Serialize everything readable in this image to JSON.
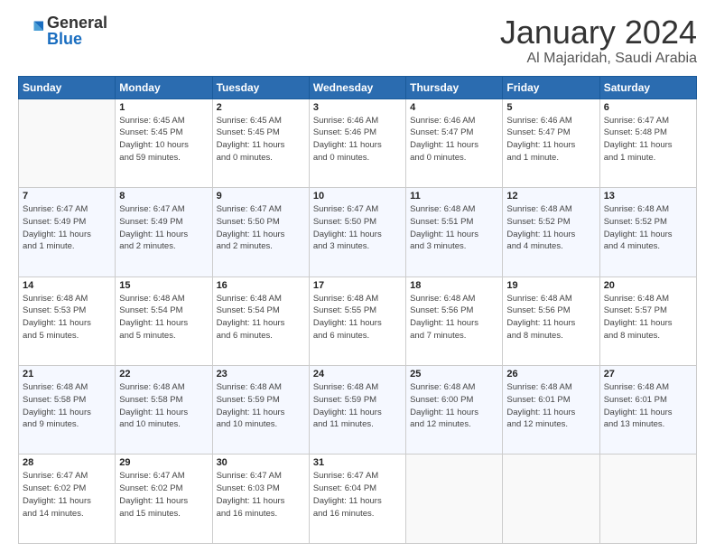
{
  "logo": {
    "general": "General",
    "blue": "Blue"
  },
  "title": "January 2024",
  "subtitle": "Al Majaridah, Saudi Arabia",
  "days_header": [
    "Sunday",
    "Monday",
    "Tuesday",
    "Wednesday",
    "Thursday",
    "Friday",
    "Saturday"
  ],
  "weeks": [
    [
      {
        "num": "",
        "detail": ""
      },
      {
        "num": "1",
        "detail": "Sunrise: 6:45 AM\nSunset: 5:45 PM\nDaylight: 10 hours\nand 59 minutes."
      },
      {
        "num": "2",
        "detail": "Sunrise: 6:45 AM\nSunset: 5:45 PM\nDaylight: 11 hours\nand 0 minutes."
      },
      {
        "num": "3",
        "detail": "Sunrise: 6:46 AM\nSunset: 5:46 PM\nDaylight: 11 hours\nand 0 minutes."
      },
      {
        "num": "4",
        "detail": "Sunrise: 6:46 AM\nSunset: 5:47 PM\nDaylight: 11 hours\nand 0 minutes."
      },
      {
        "num": "5",
        "detail": "Sunrise: 6:46 AM\nSunset: 5:47 PM\nDaylight: 11 hours\nand 1 minute."
      },
      {
        "num": "6",
        "detail": "Sunrise: 6:47 AM\nSunset: 5:48 PM\nDaylight: 11 hours\nand 1 minute."
      }
    ],
    [
      {
        "num": "7",
        "detail": "Sunrise: 6:47 AM\nSunset: 5:49 PM\nDaylight: 11 hours\nand 1 minute."
      },
      {
        "num": "8",
        "detail": "Sunrise: 6:47 AM\nSunset: 5:49 PM\nDaylight: 11 hours\nand 2 minutes."
      },
      {
        "num": "9",
        "detail": "Sunrise: 6:47 AM\nSunset: 5:50 PM\nDaylight: 11 hours\nand 2 minutes."
      },
      {
        "num": "10",
        "detail": "Sunrise: 6:47 AM\nSunset: 5:50 PM\nDaylight: 11 hours\nand 3 minutes."
      },
      {
        "num": "11",
        "detail": "Sunrise: 6:48 AM\nSunset: 5:51 PM\nDaylight: 11 hours\nand 3 minutes."
      },
      {
        "num": "12",
        "detail": "Sunrise: 6:48 AM\nSunset: 5:52 PM\nDaylight: 11 hours\nand 4 minutes."
      },
      {
        "num": "13",
        "detail": "Sunrise: 6:48 AM\nSunset: 5:52 PM\nDaylight: 11 hours\nand 4 minutes."
      }
    ],
    [
      {
        "num": "14",
        "detail": "Sunrise: 6:48 AM\nSunset: 5:53 PM\nDaylight: 11 hours\nand 5 minutes."
      },
      {
        "num": "15",
        "detail": "Sunrise: 6:48 AM\nSunset: 5:54 PM\nDaylight: 11 hours\nand 5 minutes."
      },
      {
        "num": "16",
        "detail": "Sunrise: 6:48 AM\nSunset: 5:54 PM\nDaylight: 11 hours\nand 6 minutes."
      },
      {
        "num": "17",
        "detail": "Sunrise: 6:48 AM\nSunset: 5:55 PM\nDaylight: 11 hours\nand 6 minutes."
      },
      {
        "num": "18",
        "detail": "Sunrise: 6:48 AM\nSunset: 5:56 PM\nDaylight: 11 hours\nand 7 minutes."
      },
      {
        "num": "19",
        "detail": "Sunrise: 6:48 AM\nSunset: 5:56 PM\nDaylight: 11 hours\nand 8 minutes."
      },
      {
        "num": "20",
        "detail": "Sunrise: 6:48 AM\nSunset: 5:57 PM\nDaylight: 11 hours\nand 8 minutes."
      }
    ],
    [
      {
        "num": "21",
        "detail": "Sunrise: 6:48 AM\nSunset: 5:58 PM\nDaylight: 11 hours\nand 9 minutes."
      },
      {
        "num": "22",
        "detail": "Sunrise: 6:48 AM\nSunset: 5:58 PM\nDaylight: 11 hours\nand 10 minutes."
      },
      {
        "num": "23",
        "detail": "Sunrise: 6:48 AM\nSunset: 5:59 PM\nDaylight: 11 hours\nand 10 minutes."
      },
      {
        "num": "24",
        "detail": "Sunrise: 6:48 AM\nSunset: 5:59 PM\nDaylight: 11 hours\nand 11 minutes."
      },
      {
        "num": "25",
        "detail": "Sunrise: 6:48 AM\nSunset: 6:00 PM\nDaylight: 11 hours\nand 12 minutes."
      },
      {
        "num": "26",
        "detail": "Sunrise: 6:48 AM\nSunset: 6:01 PM\nDaylight: 11 hours\nand 12 minutes."
      },
      {
        "num": "27",
        "detail": "Sunrise: 6:48 AM\nSunset: 6:01 PM\nDaylight: 11 hours\nand 13 minutes."
      }
    ],
    [
      {
        "num": "28",
        "detail": "Sunrise: 6:47 AM\nSunset: 6:02 PM\nDaylight: 11 hours\nand 14 minutes."
      },
      {
        "num": "29",
        "detail": "Sunrise: 6:47 AM\nSunset: 6:02 PM\nDaylight: 11 hours\nand 15 minutes."
      },
      {
        "num": "30",
        "detail": "Sunrise: 6:47 AM\nSunset: 6:03 PM\nDaylight: 11 hours\nand 16 minutes."
      },
      {
        "num": "31",
        "detail": "Sunrise: 6:47 AM\nSunset: 6:04 PM\nDaylight: 11 hours\nand 16 minutes."
      },
      {
        "num": "",
        "detail": ""
      },
      {
        "num": "",
        "detail": ""
      },
      {
        "num": "",
        "detail": ""
      }
    ]
  ]
}
